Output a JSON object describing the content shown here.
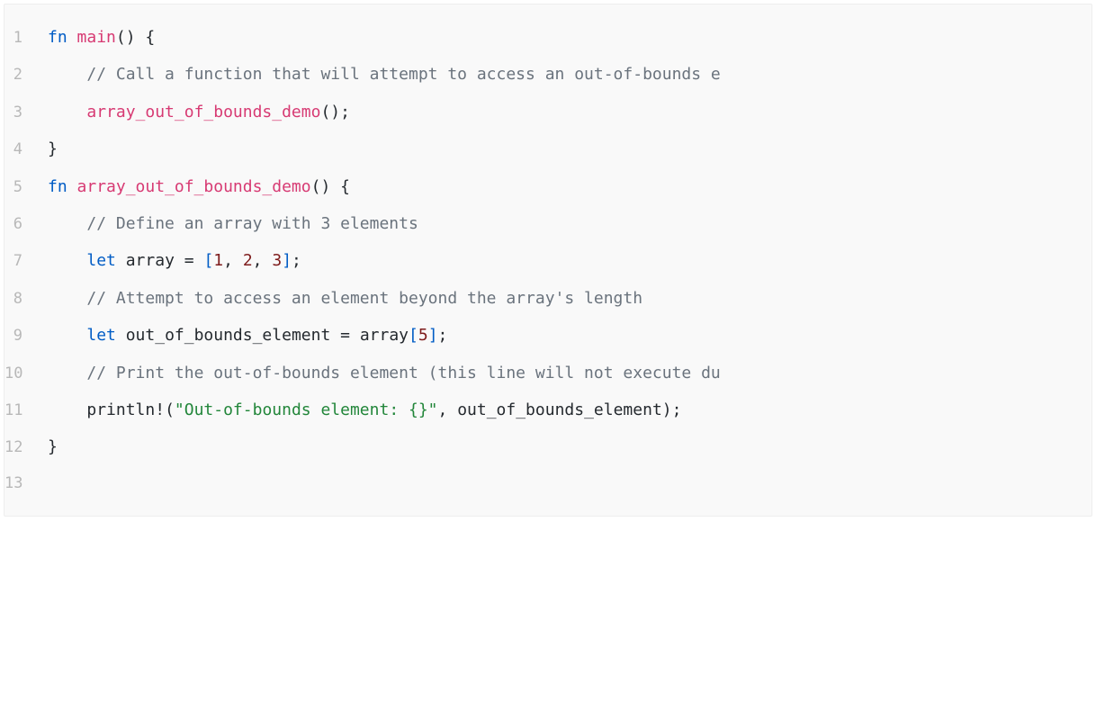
{
  "code": {
    "language": "rust",
    "lines": [
      {
        "num": "1",
        "indent": 0,
        "tokens": [
          {
            "t": "fn ",
            "c": "tok-keyword"
          },
          {
            "t": "main",
            "c": "tok-fn-name"
          },
          {
            "t": "()",
            "c": "tok-paren"
          },
          {
            "t": " {",
            "c": "tok-brace"
          }
        ]
      },
      {
        "num": "2",
        "indent": 1,
        "tokens": [
          {
            "t": "// Call a function that will attempt to access an out-of-bounds e",
            "c": "tok-comment"
          }
        ]
      },
      {
        "num": "3",
        "indent": 1,
        "tokens": [
          {
            "t": "array_out_of_bounds_demo",
            "c": "tok-fn-name"
          },
          {
            "t": "()",
            "c": "tok-paren"
          },
          {
            "t": ";",
            "c": "tok-semi"
          }
        ]
      },
      {
        "num": "4",
        "indent": 0,
        "tokens": [
          {
            "t": "}",
            "c": "tok-brace"
          }
        ]
      },
      {
        "num": "5",
        "indent": 0,
        "tokens": [
          {
            "t": "fn ",
            "c": "tok-keyword"
          },
          {
            "t": "array_out_of_bounds_demo",
            "c": "tok-fn-name"
          },
          {
            "t": "()",
            "c": "tok-paren"
          },
          {
            "t": " {",
            "c": "tok-brace"
          }
        ]
      },
      {
        "num": "6",
        "indent": 1,
        "tokens": [
          {
            "t": "// Define an array with 3 elements",
            "c": "tok-comment"
          }
        ]
      },
      {
        "num": "7",
        "indent": 1,
        "tokens": [
          {
            "t": "let ",
            "c": "tok-keyword"
          },
          {
            "t": "array ",
            "c": "tok-ident"
          },
          {
            "t": "= ",
            "c": "tok-op"
          },
          {
            "t": "[",
            "c": "tok-bracket"
          },
          {
            "t": "1",
            "c": "tok-number"
          },
          {
            "t": ", ",
            "c": "tok-punct"
          },
          {
            "t": "2",
            "c": "tok-number"
          },
          {
            "t": ", ",
            "c": "tok-punct"
          },
          {
            "t": "3",
            "c": "tok-number"
          },
          {
            "t": "]",
            "c": "tok-bracket"
          },
          {
            "t": ";",
            "c": "tok-semi"
          }
        ]
      },
      {
        "num": "8",
        "indent": 1,
        "tokens": [
          {
            "t": "// Attempt to access an element beyond the array's length",
            "c": "tok-comment"
          }
        ]
      },
      {
        "num": "9",
        "indent": 1,
        "tokens": [
          {
            "t": "let ",
            "c": "tok-keyword"
          },
          {
            "t": "out_of_bounds_element ",
            "c": "tok-ident"
          },
          {
            "t": "= ",
            "c": "tok-op"
          },
          {
            "t": "array",
            "c": "tok-ident"
          },
          {
            "t": "[",
            "c": "tok-bracket"
          },
          {
            "t": "5",
            "c": "tok-number"
          },
          {
            "t": "]",
            "c": "tok-bracket"
          },
          {
            "t": ";",
            "c": "tok-semi"
          }
        ]
      },
      {
        "num": "10",
        "indent": 1,
        "tokens": [
          {
            "t": "// Print the out-of-bounds element (this line will not execute du",
            "c": "tok-comment"
          }
        ]
      },
      {
        "num": "11",
        "indent": 1,
        "tokens": [
          {
            "t": "println!",
            "c": "tok-macro"
          },
          {
            "t": "(",
            "c": "tok-paren"
          },
          {
            "t": "\"Out-of-bounds element: {}\"",
            "c": "tok-string"
          },
          {
            "t": ", ",
            "c": "tok-punct"
          },
          {
            "t": "out_of_bounds_element",
            "c": "tok-ident"
          },
          {
            "t": ")",
            "c": "tok-paren"
          },
          {
            "t": ";",
            "c": "tok-semi"
          }
        ]
      },
      {
        "num": "12",
        "indent": 0,
        "tokens": [
          {
            "t": "}",
            "c": "tok-brace"
          }
        ]
      },
      {
        "num": "13",
        "indent": 0,
        "tokens": []
      }
    ],
    "indent_unit": "    "
  }
}
